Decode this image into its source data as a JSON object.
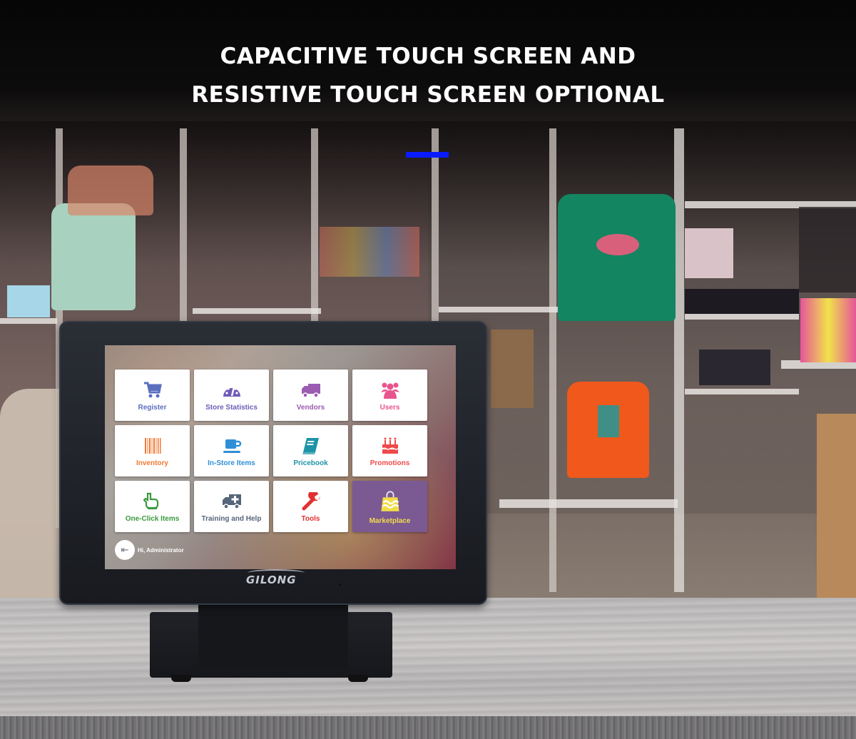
{
  "headline": {
    "line1": "CAPACITIVE TOUCH SCREEN AND",
    "line2": "RESISTIVE TOUCH SCREEN OPTIONAL",
    "accent_color": "#0a1cff"
  },
  "device": {
    "brand": "GILONG"
  },
  "pos_screen": {
    "tiles": [
      {
        "label": "Register",
        "icon": "shopping-cart-icon",
        "color": "#5b6fbf"
      },
      {
        "label": "Store Statistics",
        "icon": "dashboard-gauge-icon",
        "color": "#6e5bb8"
      },
      {
        "label": "Vendors",
        "icon": "truck-icon",
        "color": "#9b5bb0"
      },
      {
        "label": "Users",
        "icon": "users-group-icon",
        "color": "#e8558e"
      },
      {
        "label": "Inventory",
        "icon": "barcode-icon",
        "color": "#f07a35"
      },
      {
        "label": "In-Store Items",
        "icon": "coffee-cup-icon",
        "color": "#2f8fd6"
      },
      {
        "label": "Pricebook",
        "icon": "book-icon",
        "color": "#1e93a8"
      },
      {
        "label": "Promotions",
        "icon": "birthday-cake-icon",
        "color": "#ee4a4a"
      },
      {
        "label": "One-Click Items",
        "icon": "pointing-hand-icon",
        "color": "#3a9a3f"
      },
      {
        "label": "Training and Help",
        "icon": "ambulance-icon",
        "color": "#55657a"
      },
      {
        "label": "Tools",
        "icon": "wrench-icon",
        "color": "#e23030"
      },
      {
        "label": "Marketplace",
        "icon": "shopping-bag-icon",
        "color": "#f2dc4a",
        "background": "#7b5a93"
      }
    ],
    "greeting": "Hi, Administrator",
    "logout_icon": "sign-out-icon"
  }
}
